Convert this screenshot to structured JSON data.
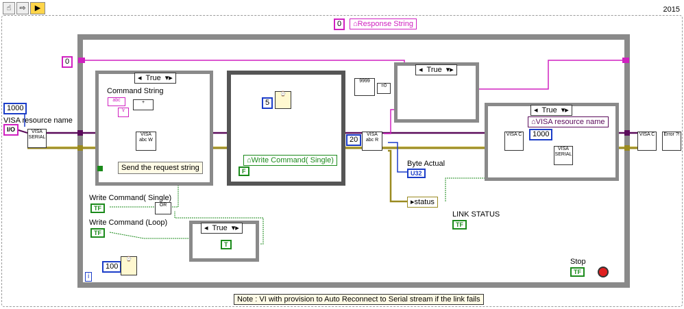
{
  "toolbar": {
    "run_label": "▶"
  },
  "version": "2015",
  "response_string": {
    "const": "0",
    "label": "Response String"
  },
  "top_const": "0",
  "visa": {
    "const": "1000",
    "label": "VISA resource name",
    "io_tag": "I/O",
    "icon": "VISA SERIAL"
  },
  "case1": {
    "selector": "True",
    "command_label": "Command String",
    "comment": "Send the request string"
  },
  "sequence": {
    "wait_const": "5",
    "local": "Write Command( Single)",
    "bool_const": "F"
  },
  "read": {
    "count_const": "20",
    "byte_label": "Byte Actual",
    "byte_term": "U32",
    "status_local": "status"
  },
  "case2": {
    "selector": "True"
  },
  "case3": {
    "selector": "True",
    "local": "VISA resource name",
    "const": "1000"
  },
  "link": {
    "label": "LINK STATUS",
    "term": "TF"
  },
  "controls": {
    "write_single": "Write Command( Single)",
    "write_loop": "Write Command (Loop)",
    "bool_term": "TF",
    "case4_selector": "True",
    "true_const": "T"
  },
  "loop": {
    "wait_const": "100",
    "iter": "i"
  },
  "stop": {
    "label": "Stop",
    "term": "TF"
  },
  "note": "Note : VI  with provision to Auto Reconnect to Serial stream if the link fails",
  "colors": {
    "string": "#d020c0",
    "visa": "#5a0a5a",
    "error": "#9a8a20",
    "bool": "#1a8a1a",
    "number": "#1a3cc8"
  }
}
